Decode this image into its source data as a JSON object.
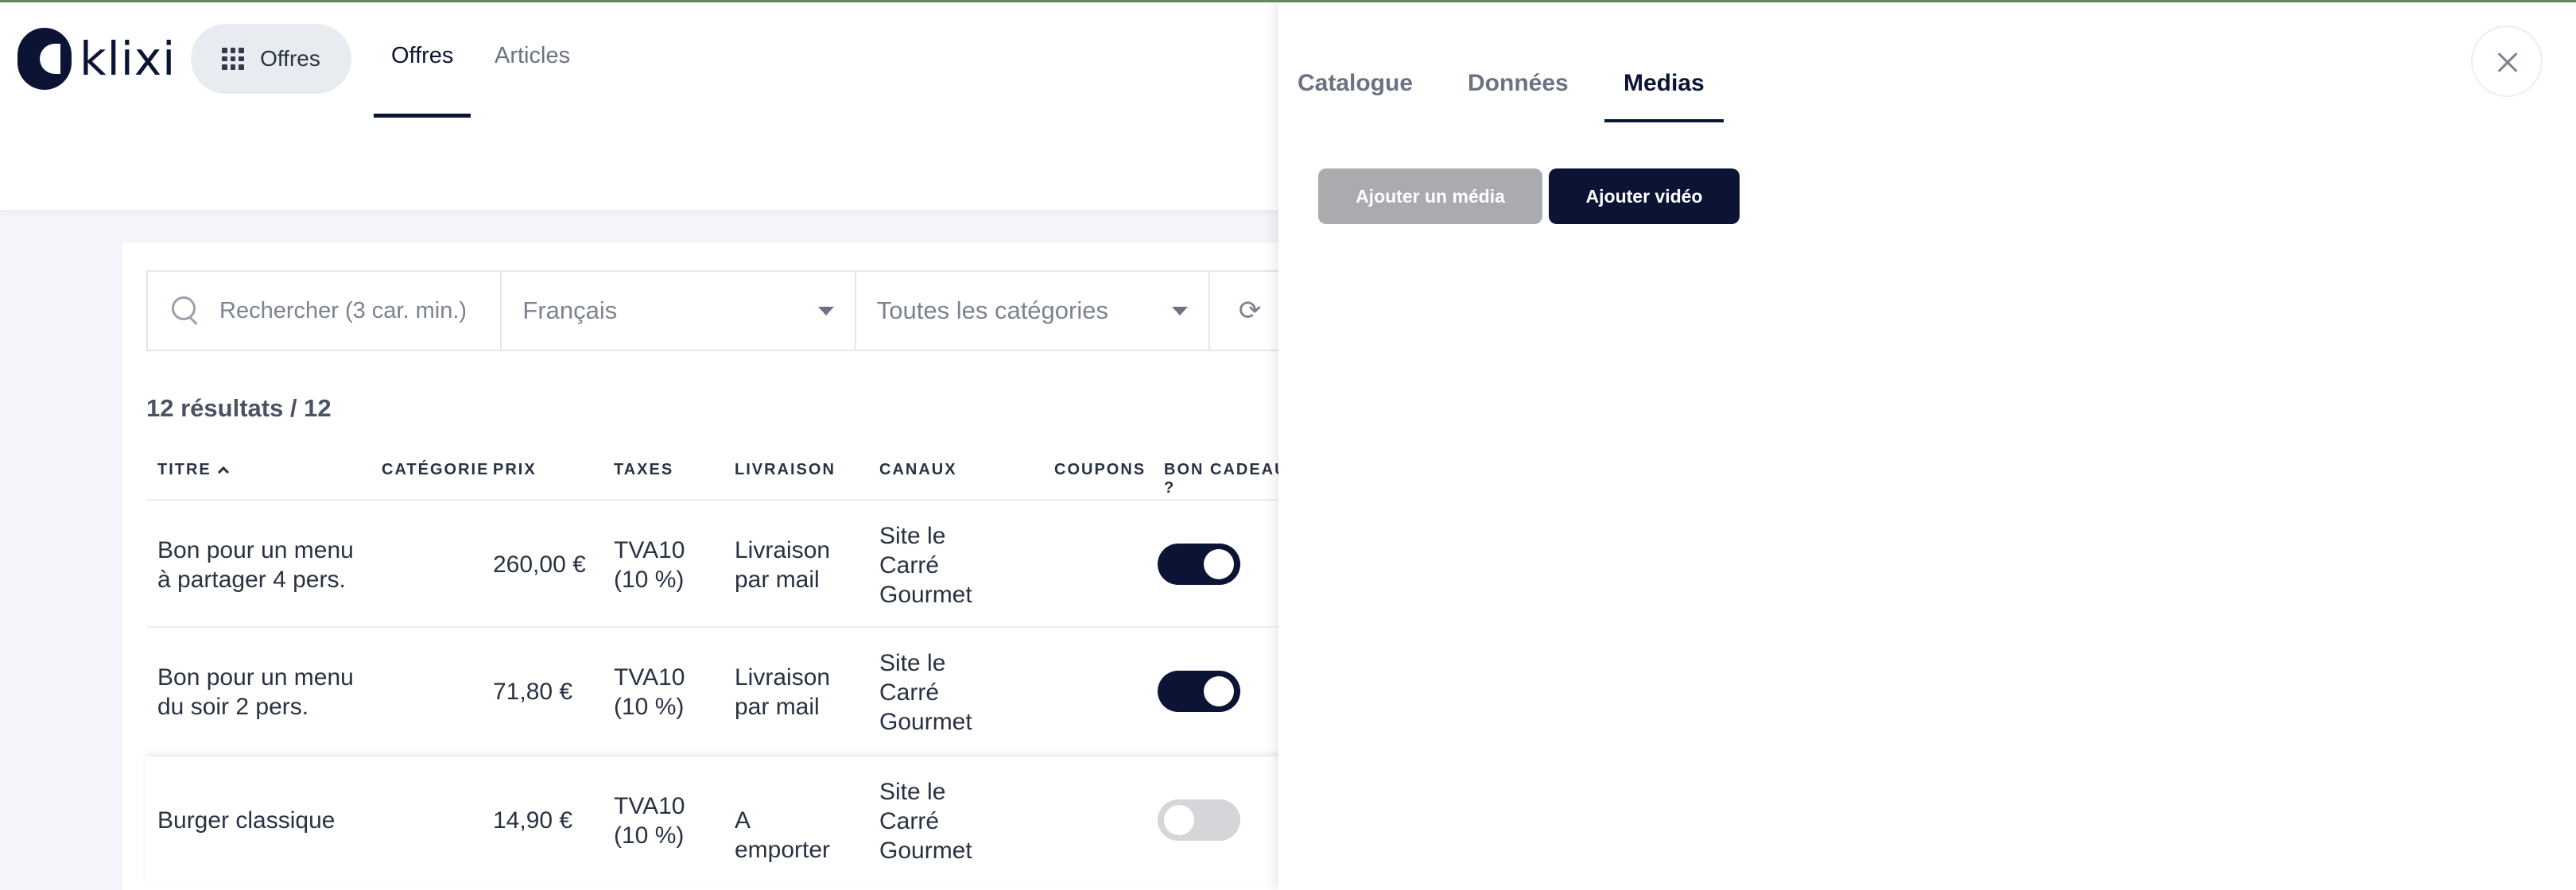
{
  "header": {
    "logo_text": "klixi",
    "apps_label": "Offres",
    "tabs": [
      {
        "label": "Offres",
        "active": true
      },
      {
        "label": "Articles",
        "active": false
      }
    ]
  },
  "filters": {
    "search_placeholder": "Rechercher (3 car. min.)",
    "language": "Français",
    "category": "Toutes les catégories"
  },
  "results": "12 résultats / 12",
  "table": {
    "columns": [
      "TITRE",
      "CATÉGORIE",
      "PRIX",
      "TAXES",
      "LIVRAISON",
      "CANAUX",
      "COUPONS",
      "BON CADEAU ?"
    ],
    "rows": [
      {
        "title": "Bon pour un menu à partager 4 pers.",
        "category": "",
        "price": "260,00 €",
        "tax": "TVA10 (10 %)",
        "delivery": "Livraison par mail",
        "channels": "Site le Carré Gourmet",
        "coupons": "",
        "gift_card": true
      },
      {
        "title": "Bon pour un menu du soir 2 pers.",
        "category": "",
        "price": "71,80 €",
        "tax": "TVA10 (10 %)",
        "delivery": "Livraison par mail",
        "channels": "Site le Carré Gourmet",
        "coupons": "",
        "gift_card": true
      },
      {
        "title": "Burger classique",
        "category": "",
        "price": "14,90 €",
        "tax": "TVA10 (10 %)",
        "delivery": "A emporter",
        "channels": "Site le Carré Gourmet",
        "coupons": "",
        "gift_card": false
      }
    ]
  },
  "panel": {
    "tabs": [
      {
        "label": "Catalogue",
        "active": false
      },
      {
        "label": "Données",
        "active": false
      },
      {
        "label": "Medias",
        "active": true
      }
    ],
    "add_media_label": "Ajouter un média",
    "add_video_label": "Ajouter vidéo"
  },
  "colors": {
    "brand": "#0b1435",
    "toggle_off": "#d4d6da",
    "button_disabled": "#a9abaf",
    "background": "#f3f5f9"
  },
  "icons": [
    "apps-grid-icon",
    "search-icon",
    "chevron-down-icon",
    "refresh-icon",
    "sort-asc-icon",
    "close-icon"
  ]
}
